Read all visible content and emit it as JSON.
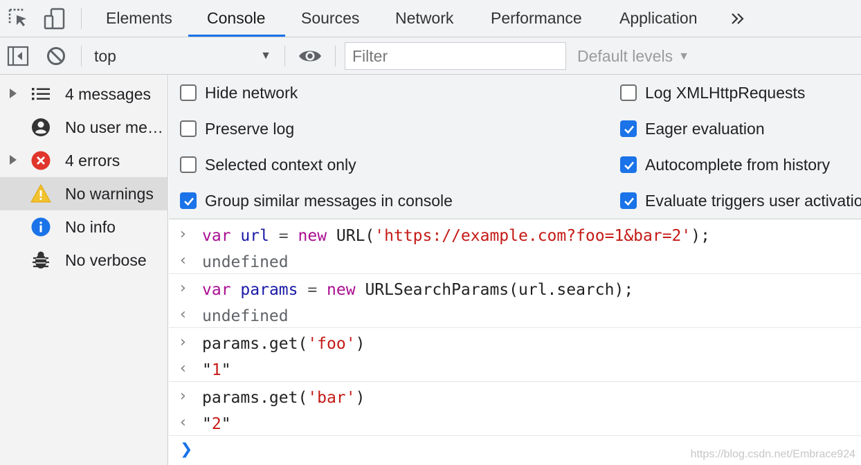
{
  "tabs": [
    {
      "label": "Elements",
      "active": false
    },
    {
      "label": "Console",
      "active": true
    },
    {
      "label": "Sources",
      "active": false
    },
    {
      "label": "Network",
      "active": false
    },
    {
      "label": "Performance",
      "active": false
    },
    {
      "label": "Application",
      "active": false
    }
  ],
  "toolbar": {
    "context": "top",
    "filter_placeholder": "Filter",
    "filter_value": "",
    "levels_label": "Default levels"
  },
  "sidebar": {
    "items": [
      {
        "label": "4 messages",
        "icon": "list-icon",
        "expandable": true,
        "selected": false
      },
      {
        "label": "No user messages",
        "icon": "user-icon",
        "expandable": false,
        "selected": false
      },
      {
        "label": "4 errors",
        "icon": "error-icon",
        "expandable": true,
        "selected": false
      },
      {
        "label": "No warnings",
        "icon": "warning-icon",
        "expandable": false,
        "selected": true
      },
      {
        "label": "No info",
        "icon": "info-icon",
        "expandable": false,
        "selected": false
      },
      {
        "label": "No verbose",
        "icon": "bug-icon",
        "expandable": false,
        "selected": false
      }
    ]
  },
  "settings": {
    "left": [
      {
        "label": "Hide network",
        "checked": false
      },
      {
        "label": "Preserve log",
        "checked": false
      },
      {
        "label": "Selected context only",
        "checked": false
      },
      {
        "label": "Group similar messages in console",
        "checked": true
      }
    ],
    "right": [
      {
        "label": "Log XMLHttpRequests",
        "checked": false
      },
      {
        "label": "Eager evaluation",
        "checked": true
      },
      {
        "label": "Autocomplete from history",
        "checked": true
      },
      {
        "label": "Evaluate triggers user activation",
        "checked": true
      }
    ]
  },
  "console": {
    "entries": [
      {
        "input": [
          {
            "t": "var",
            "c": "kw"
          },
          {
            "t": " ",
            "c": ""
          },
          {
            "t": "url",
            "c": "vr"
          },
          {
            "t": " = ",
            "c": "op"
          },
          {
            "t": "new",
            "c": "kw"
          },
          {
            "t": " URL(",
            "c": ""
          },
          {
            "t": "'https://example.com?foo=1&bar=2'",
            "c": "str"
          },
          {
            "t": ");",
            "c": ""
          }
        ],
        "output": [
          {
            "t": "undefined",
            "c": "undef"
          }
        ]
      },
      {
        "input": [
          {
            "t": "var",
            "c": "kw"
          },
          {
            "t": " ",
            "c": ""
          },
          {
            "t": "params",
            "c": "vr"
          },
          {
            "t": " = ",
            "c": "op"
          },
          {
            "t": "new",
            "c": "kw"
          },
          {
            "t": " URLSearchParams(url.search);",
            "c": ""
          }
        ],
        "output": [
          {
            "t": "undefined",
            "c": "undef"
          }
        ]
      },
      {
        "input": [
          {
            "t": "params.get(",
            "c": ""
          },
          {
            "t": "'foo'",
            "c": "str"
          },
          {
            "t": ")",
            "c": ""
          }
        ],
        "output": [
          {
            "t": "\"",
            "c": ""
          },
          {
            "t": "1",
            "c": "str"
          },
          {
            "t": "\"",
            "c": ""
          }
        ]
      },
      {
        "input": [
          {
            "t": "params.get(",
            "c": ""
          },
          {
            "t": "'bar'",
            "c": "str"
          },
          {
            "t": ")",
            "c": ""
          }
        ],
        "output": [
          {
            "t": "\"",
            "c": ""
          },
          {
            "t": "2",
            "c": "str"
          },
          {
            "t": "\"",
            "c": ""
          }
        ]
      }
    ],
    "input_prompt": ">",
    "output_prompt": "<·"
  },
  "watermark": "https://blog.csdn.net/Embrace924",
  "colors": {
    "accent": "#1a73e8",
    "error": "#e0352b",
    "warning": "#f2c12e",
    "info": "#1a73e8"
  }
}
